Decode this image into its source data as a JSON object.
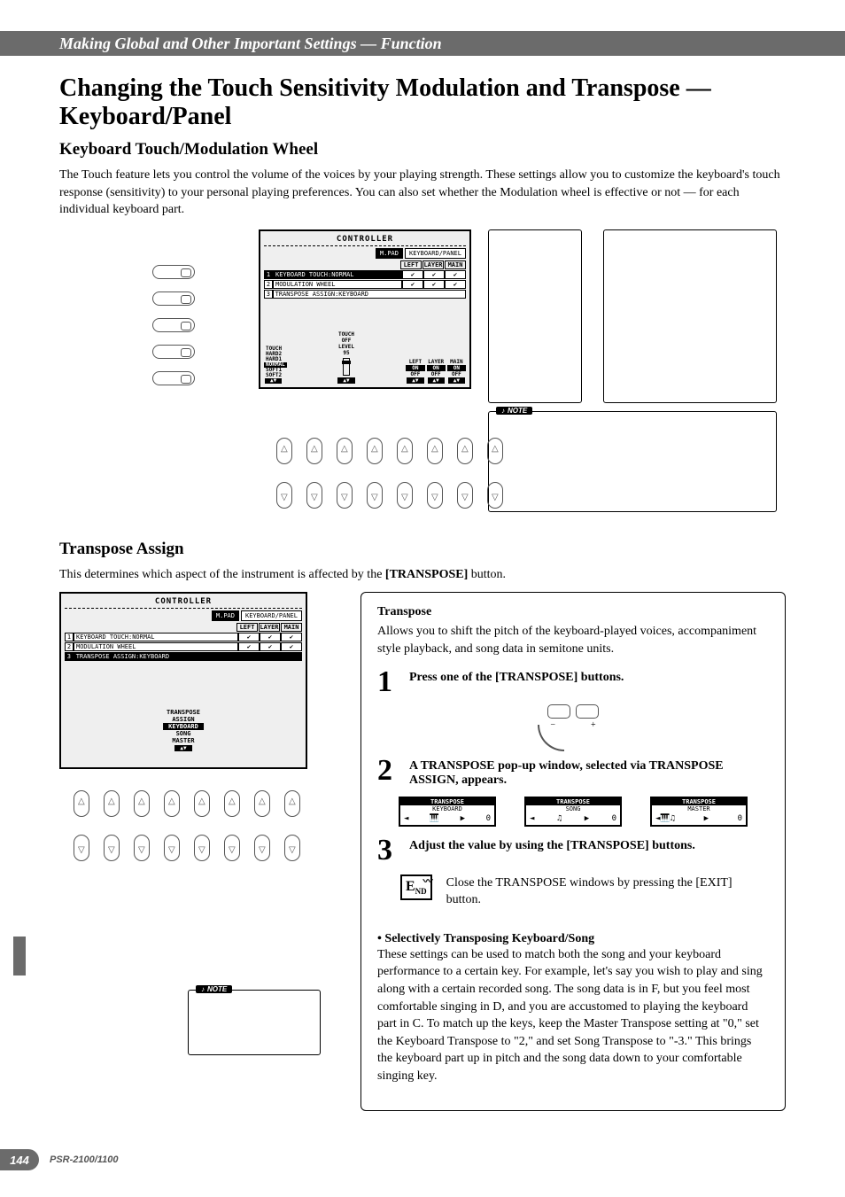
{
  "header": {
    "breadcrumb": "Making Global and Other Important Settings — Function"
  },
  "page": {
    "number": "144",
    "model": "PSR-2100/1100"
  },
  "section1": {
    "title": "Changing the Touch Sensitivity Modulation and Transpose — Keyboard/Panel",
    "subtitle": "Keyboard Touch/Modulation Wheel",
    "intro": "The Touch feature lets you control the volume of the voices by your playing strength. These settings allow you to customize the keyboard's touch response (sensitivity) to your personal playing preferences. You can also set whether the Modulation wheel is effective or not — for each individual keyboard part.",
    "lcd": {
      "title": "CONTROLLER",
      "tab1": "M.PAD",
      "tab2": "KEYBOARD/PANEL",
      "headers": [
        "LEFT",
        "LAYER",
        "MAIN"
      ],
      "rows": [
        {
          "num": "1",
          "label": "KEYBOARD TOUCH:NORMAL",
          "checks": [
            "✔",
            "✔",
            "✔"
          ],
          "sel": true
        },
        {
          "num": "2",
          "label": "MODULATION WHEEL",
          "checks": [
            "✔",
            "✔",
            "✔"
          ],
          "sel": false
        },
        {
          "num": "3",
          "label": "TRANSPOSE ASSIGN:KEYBOARD",
          "checks": null,
          "sel": false
        }
      ],
      "touchList": [
        "HARD2",
        "HARD1",
        "NORMAL",
        "SOFT1",
        "SOFT2"
      ],
      "touchSel": "NORMAL",
      "touchLabel": "TOUCH",
      "level": {
        "label": "TOUCH\nOFF\nLEVEL",
        "value": "95"
      },
      "toggles": [
        {
          "name": "LEFT",
          "on": "ON",
          "off": "OFF"
        },
        {
          "name": "LAYER",
          "on": "ON",
          "off": "OFF"
        },
        {
          "name": "MAIN",
          "on": "ON",
          "off": "OFF"
        }
      ]
    },
    "note_label": "NOTE"
  },
  "section2": {
    "subtitle": "Transpose Assign",
    "intro_a": "This determines which aspect of the instrument is affected by the ",
    "intro_b": "[TRANSPOSE]",
    "intro_c": " button.",
    "lcd": {
      "title": "CONTROLLER",
      "tab1": "M.PAD",
      "tab2": "KEYBOARD/PANEL",
      "headers": [
        "LEFT",
        "LAYER",
        "MAIN"
      ],
      "rows": [
        {
          "num": "1",
          "label": "KEYBOARD TOUCH:NORMAL",
          "checks": [
            "✔",
            "✔",
            "✔"
          ],
          "sel": false
        },
        {
          "num": "2",
          "label": "MODULATION WHEEL",
          "checks": [
            "✔",
            "✔",
            "✔"
          ],
          "sel": false
        },
        {
          "num": "3",
          "label": "TRANSPOSE ASSIGN:KEYBOARD",
          "checks": null,
          "sel": true
        }
      ],
      "trLabel": "TRANSPOSE\nASSIGN",
      "trList": [
        "KEYBOARD",
        "SONG",
        "MASTER"
      ],
      "trSel": "KEYBOARD"
    },
    "note_label": "NOTE",
    "box": {
      "heading": "Transpose",
      "desc": "Allows you to shift the pitch of the keyboard-played voices, accompaniment style playback, and song data in semitone units.",
      "step1": "Press one of the [TRANSPOSE] buttons.",
      "step2": "A TRANSPOSE pop-up window, selected via TRANSPOSE ASSIGN, appears.",
      "step3": "Adjust the value by using the [TRANSPOSE] buttons.",
      "end_text": "Close the TRANSPOSE windows by pressing the [EXIT] button.",
      "end_label": "END",
      "example_heading": "• Selectively Transposing Keyboard/Song",
      "example_text": "These settings can be used to match both the song and your keyboard performance to a certain key. For example, let's say you wish to play and sing along with a certain recorded song. The song data is in F, but you feel most comfortable singing in D, and you are accustomed to playing the keyboard part in C. To match up the keys, keep the Master Transpose setting at \"0,\" set the Keyboard Transpose to \"2,\" and set Song Transpose to \"-3.\" This brings the keyboard part up in pitch and the song data down to your comfortable singing key.",
      "popups": [
        {
          "title": "TRANSPOSE",
          "sub": "KEYBOARD",
          "icon": "🎹",
          "val": "0"
        },
        {
          "title": "TRANSPOSE",
          "sub": "SONG",
          "icon": "♫",
          "val": "0"
        },
        {
          "title": "TRANSPOSE",
          "sub": "MASTER",
          "icon": "◄🎹♫",
          "val": "0"
        }
      ]
    }
  }
}
